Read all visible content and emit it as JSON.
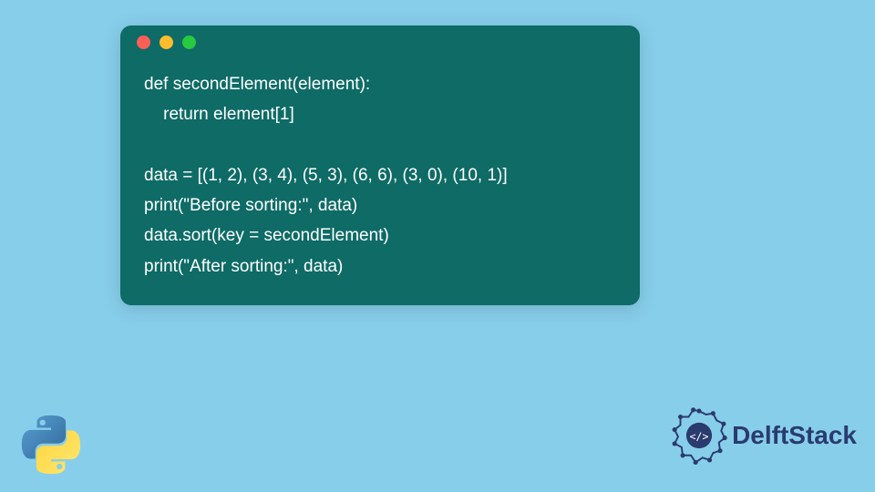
{
  "code": {
    "lines": [
      "def secondElement(element):",
      "    return element[1]",
      "",
      "data = [(1, 2), (3, 4), (5, 3), (6, 6), (3, 0), (10, 1)]",
      "print(\"Before sorting:\", data)",
      "data.sort(key = secondElement)",
      "print(\"After sorting:\", data)"
    ]
  },
  "brand": {
    "name": "DelftStack"
  },
  "colors": {
    "background": "#87ceeb",
    "codeBlock": "#0e6b66",
    "brandText": "#2a3b6e",
    "dotRed": "#ff5f56",
    "dotYellow": "#ffbd2e",
    "dotGreen": "#27c93f"
  }
}
